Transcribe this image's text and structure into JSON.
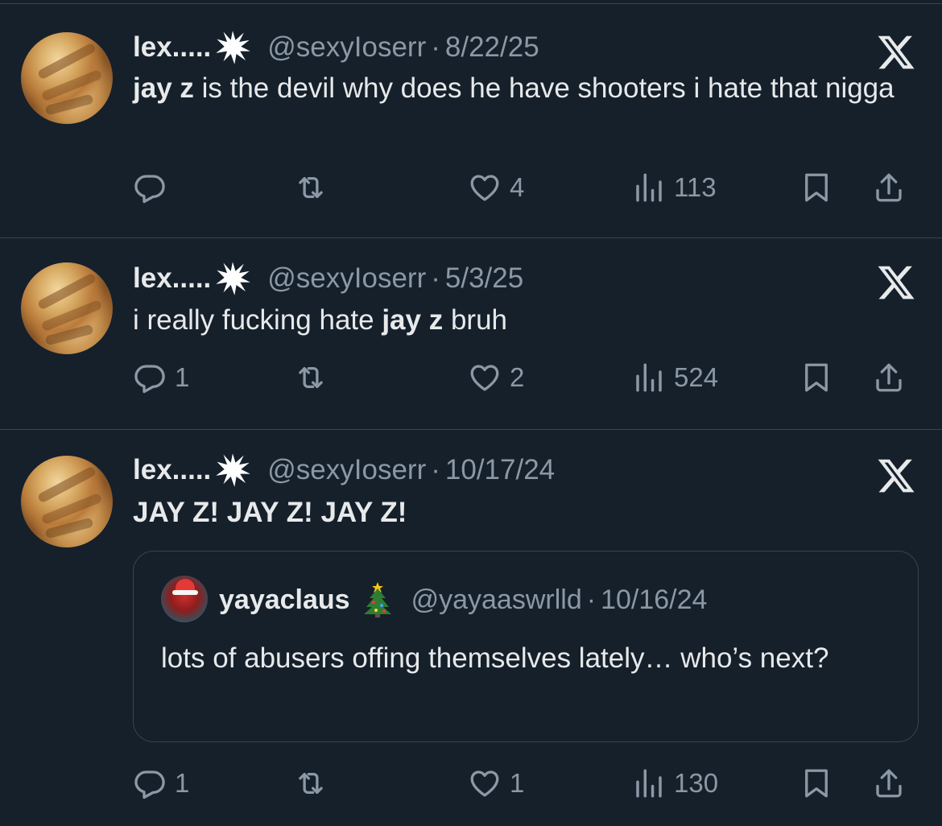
{
  "tweets": [
    {
      "author": {
        "name": "lex.....",
        "handle": "@sexyIoserr",
        "badge_icon": "burst-icon"
      },
      "date": "8/22/25",
      "text_parts": [
        {
          "text": "jay z",
          "bold": true
        },
        {
          "text": " is the devil why does he have shooters i hate that nigga",
          "bold": false
        }
      ],
      "stats": {
        "replies": "",
        "reposts": "",
        "likes": "4",
        "views": "113"
      }
    },
    {
      "author": {
        "name": "lex.....",
        "handle": "@sexyIoserr",
        "badge_icon": "burst-icon"
      },
      "date": "5/3/25",
      "text_parts": [
        {
          "text": "i really fucking hate ",
          "bold": false
        },
        {
          "text": "jay z",
          "bold": true
        },
        {
          "text": " bruh",
          "bold": false
        }
      ],
      "stats": {
        "replies": "1",
        "reposts": "",
        "likes": "2",
        "views": "524"
      }
    },
    {
      "author": {
        "name": "lex.....",
        "handle": "@sexyIoserr",
        "badge_icon": "burst-icon"
      },
      "date": "10/17/24",
      "text_parts": [
        {
          "text": "JAY Z! JAY Z! JAY Z!",
          "bold": true
        }
      ],
      "quote": {
        "author": {
          "name": "yayaclaus",
          "handle": "@yayaaswrlld",
          "emoji": "🎄"
        },
        "date": "10/16/24",
        "text": "lots of abusers offing themselves lately… who’s next?"
      },
      "stats": {
        "replies": "1",
        "reposts": "",
        "likes": "1",
        "views": "130"
      }
    }
  ],
  "colors": {
    "background": "#15202b",
    "text": "#e7e9ea",
    "secondary": "#8b98a5",
    "divider": "#38444d"
  },
  "icons": {
    "source": "x-logo-icon",
    "reply": "reply-icon",
    "repost": "repost-icon",
    "like": "heart-icon",
    "views": "views-icon",
    "bookmark": "bookmark-icon",
    "share": "share-icon"
  }
}
